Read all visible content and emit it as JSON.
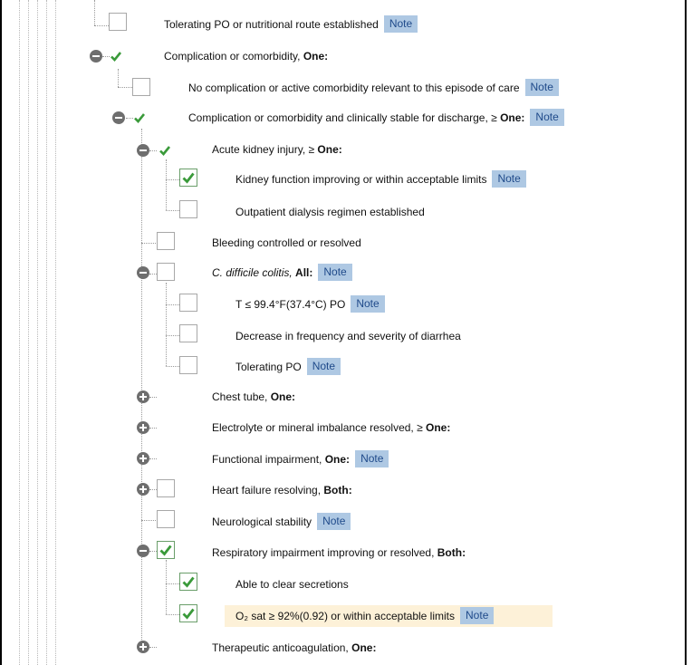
{
  "note_label": "Note",
  "colors": {
    "check": "#3a9a3a",
    "note_bg": "#aec8e3",
    "highlight": "#fdf1d8"
  },
  "rows": [
    {
      "id": "r0",
      "label": "Tolerating PO or nutritional route established",
      "bold": "",
      "note": true
    },
    {
      "id": "r1",
      "label": "Complication or comorbidity, ",
      "bold": "One:",
      "note": false
    },
    {
      "id": "r2",
      "label": "No complication or active comorbidity relevant to this episode of care",
      "bold": "",
      "note": true
    },
    {
      "id": "r3",
      "label": "Complication or comorbidity and clinically stable for discharge, ≥ ",
      "bold": "One:",
      "note": true
    },
    {
      "id": "r4",
      "label": "Acute kidney injury, ≥ ",
      "bold": "One:",
      "note": false
    },
    {
      "id": "r5",
      "label": "Kidney function improving or within acceptable limits",
      "bold": "",
      "note": true
    },
    {
      "id": "r6",
      "label": "Outpatient dialysis regimen established",
      "bold": "",
      "note": false
    },
    {
      "id": "r7",
      "label": "Bleeding controlled or resolved",
      "bold": "",
      "note": false
    },
    {
      "id": "r8",
      "italic": "C. difficile colitis,",
      "label": " ",
      "bold": "All:",
      "note": true
    },
    {
      "id": "r9",
      "label": "T ≤ 99.4°F(37.4°C) PO",
      "bold": "",
      "note": true
    },
    {
      "id": "r10",
      "label": "Decrease in frequency and severity of diarrhea",
      "bold": "",
      "note": false
    },
    {
      "id": "r11",
      "label": "Tolerating PO",
      "bold": "",
      "note": true
    },
    {
      "id": "r12",
      "label": "Chest tube, ",
      "bold": "One:",
      "note": false
    },
    {
      "id": "r13",
      "label": "Electrolyte or mineral imbalance resolved, ≥ ",
      "bold": "One:",
      "note": false
    },
    {
      "id": "r14",
      "label": "Functional impairment, ",
      "bold": "One:",
      "note": true
    },
    {
      "id": "r15",
      "label": "Heart failure resolving, ",
      "bold": "Both:",
      "note": false
    },
    {
      "id": "r16",
      "label": "Neurological stability",
      "bold": "",
      "note": true
    },
    {
      "id": "r17",
      "label": "Respiratory impairment improving or resolved, ",
      "bold": "Both:",
      "note": false
    },
    {
      "id": "r18",
      "label": "Able to clear secretions",
      "bold": "",
      "note": false
    },
    {
      "id": "r19",
      "label": "O₂ sat ≥ 92%(0.92) or within acceptable limits",
      "bold": "",
      "note": true
    },
    {
      "id": "r20",
      "label": "Therapeutic anticoagulation, ",
      "bold": "One:",
      "note": false
    }
  ]
}
